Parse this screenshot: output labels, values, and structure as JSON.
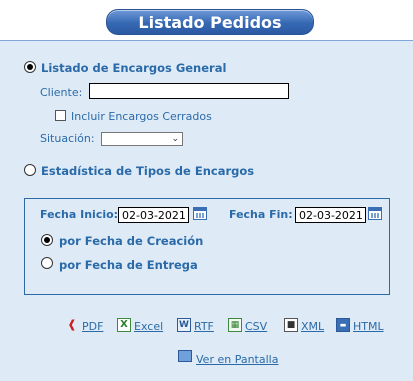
{
  "title": "Listado Pedidos",
  "general": {
    "label": "Listado de Encargos General",
    "cliente_label": "Cliente:",
    "cliente_value": "",
    "incluir_label": "Incluir Encargos Cerrados",
    "situacion_label": "Situación:",
    "situacion_value": ""
  },
  "estadistica": {
    "label": "Estadística de Tipos de Encargos"
  },
  "fechas": {
    "inicio_label": "Fecha Inicio:",
    "inicio_value": "02-03-2021",
    "fin_label": "Fecha Fin:",
    "fin_value": "02-03-2021",
    "creacion_label": "por Fecha de Creación",
    "entrega_label": "por Fecha de Entrega"
  },
  "exports": {
    "pdf": "PDF",
    "excel": "Excel",
    "rtf": "RTF",
    "csv": "CSV",
    "xml": "XML",
    "html": "HTML",
    "pantalla": "Ver en Pantalla"
  },
  "colors": {
    "accent": "#2b6aa8",
    "panel": "#deebf7",
    "title_bg": "#3668b3"
  }
}
